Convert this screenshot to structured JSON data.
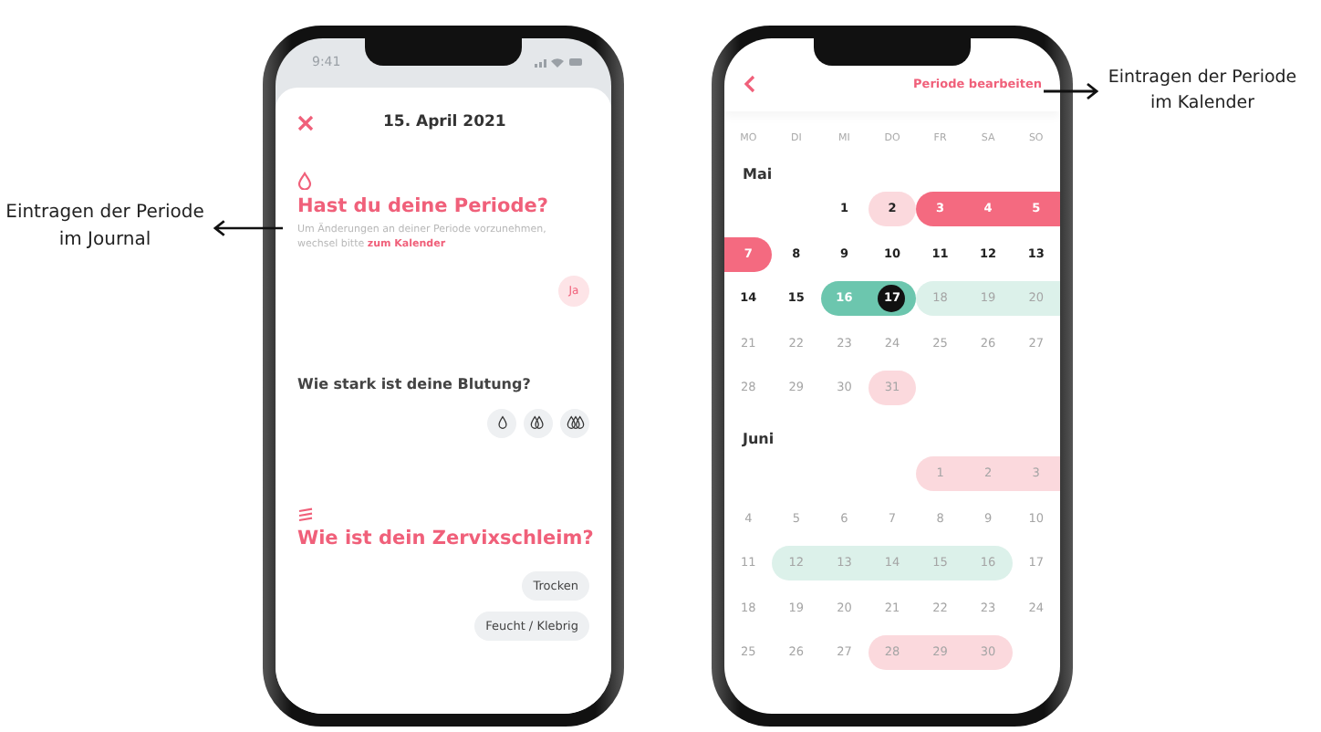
{
  "annotation_left": {
    "text": "Eintragen der Periode im Journal"
  },
  "annotation_right": {
    "text": "Eintragen der Periode im Kalender"
  },
  "journal": {
    "status_time": "9:41",
    "date": "15. April 2021",
    "period_question": "Hast du deine Periode?",
    "hint_text": "Um Änderungen an deiner Periode vorzunehmen, wechsel bitte",
    "hint_link": "zum Kalender",
    "answer": "Ja",
    "flow_question": "Wie stark ist deine Blutung?",
    "flow_levels": [
      {
        "kind": "light"
      },
      {
        "kind": "medium"
      },
      {
        "kind": "heavy"
      }
    ],
    "mucus_question": "Wie ist dein Zervixschleim?",
    "mucus_options": [
      "Trocken",
      "Feucht / Klebrig"
    ]
  },
  "calendar": {
    "action": "Periode bearbeiten",
    "weekdays": [
      "MO",
      "DI",
      "MI",
      "DO",
      "FR",
      "SA",
      "SO"
    ],
    "months": [
      {
        "name": "Mai",
        "weeks": [
          [
            {
              "kind": "empty"
            },
            {
              "kind": "empty"
            },
            {
              "day": "1",
              "kind": "plain",
              "past": true
            },
            {
              "day": "2",
              "kind": "period-light",
              "past": true
            },
            {
              "day": "3",
              "kind": "period",
              "past": true
            },
            {
              "day": "4",
              "kind": "period",
              "past": true
            },
            {
              "day": "5",
              "kind": "period",
              "past": true
            }
          ],
          [
            {
              "day": "7",
              "kind": "period",
              "past": true
            },
            {
              "day": "8",
              "kind": "plain",
              "past": true
            },
            {
              "day": "9",
              "kind": "plain",
              "past": true
            },
            {
              "day": "10",
              "kind": "plain",
              "past": true
            },
            {
              "day": "11",
              "kind": "plain",
              "past": true
            },
            {
              "day": "12",
              "kind": "plain",
              "past": true
            },
            {
              "day": "13",
              "kind": "plain",
              "past": true
            }
          ],
          [
            {
              "day": "14",
              "kind": "plain",
              "past": true
            },
            {
              "day": "15",
              "kind": "plain",
              "past": true
            },
            {
              "day": "16",
              "kind": "fertile-peak",
              "past": true
            },
            {
              "day": "17",
              "kind": "today",
              "past": true
            },
            {
              "day": "18",
              "kind": "fertile",
              "past": false
            },
            {
              "day": "19",
              "kind": "fertile",
              "past": false
            },
            {
              "day": "20",
              "kind": "fertile",
              "past": false
            }
          ],
          [
            {
              "day": "21",
              "kind": "plain",
              "past": false
            },
            {
              "day": "22",
              "kind": "plain",
              "past": false
            },
            {
              "day": "23",
              "kind": "plain",
              "past": false
            },
            {
              "day": "24",
              "kind": "plain",
              "past": false
            },
            {
              "day": "25",
              "kind": "plain",
              "past": false
            },
            {
              "day": "26",
              "kind": "plain",
              "past": false
            },
            {
              "day": "27",
              "kind": "plain",
              "past": false
            }
          ],
          [
            {
              "day": "28",
              "kind": "plain",
              "past": false
            },
            {
              "day": "29",
              "kind": "plain",
              "past": false
            },
            {
              "day": "30",
              "kind": "plain",
              "past": false
            },
            {
              "day": "31",
              "kind": "period-light",
              "past": false
            },
            {
              "kind": "empty"
            },
            {
              "kind": "empty"
            },
            {
              "kind": "empty"
            }
          ]
        ]
      },
      {
        "name": "Juni",
        "weeks": [
          [
            {
              "kind": "empty"
            },
            {
              "kind": "empty"
            },
            {
              "kind": "empty"
            },
            {
              "kind": "empty"
            },
            {
              "day": "1",
              "kind": "period-light",
              "past": false
            },
            {
              "day": "2",
              "kind": "period-light",
              "past": false
            },
            {
              "day": "3",
              "kind": "period-light",
              "past": false
            }
          ],
          [
            {
              "day": "4",
              "kind": "plain",
              "past": false
            },
            {
              "day": "5",
              "kind": "plain",
              "past": false
            },
            {
              "day": "6",
              "kind": "plain",
              "past": false
            },
            {
              "day": "7",
              "kind": "plain",
              "past": false
            },
            {
              "day": "8",
              "kind": "plain",
              "past": false
            },
            {
              "day": "9",
              "kind": "plain",
              "past": false
            },
            {
              "day": "10",
              "kind": "plain",
              "past": false
            }
          ],
          [
            {
              "day": "11",
              "kind": "plain",
              "past": false
            },
            {
              "day": "12",
              "kind": "fertile",
              "past": false
            },
            {
              "day": "13",
              "kind": "fertile",
              "past": false
            },
            {
              "day": "14",
              "kind": "fertile",
              "past": false
            },
            {
              "day": "15",
              "kind": "fertile",
              "past": false
            },
            {
              "day": "16",
              "kind": "fertile",
              "past": false
            },
            {
              "day": "17",
              "kind": "plain",
              "past": false
            }
          ],
          [
            {
              "day": "18",
              "kind": "plain",
              "past": false
            },
            {
              "day": "19",
              "kind": "plain",
              "past": false
            },
            {
              "day": "20",
              "kind": "plain",
              "past": false
            },
            {
              "day": "21",
              "kind": "plain",
              "past": false
            },
            {
              "day": "22",
              "kind": "plain",
              "past": false
            },
            {
              "day": "23",
              "kind": "plain",
              "past": false
            },
            {
              "day": "24",
              "kind": "plain",
              "past": false
            }
          ],
          [
            {
              "day": "25",
              "kind": "plain",
              "past": false
            },
            {
              "day": "26",
              "kind": "plain",
              "past": false
            },
            {
              "day": "27",
              "kind": "plain",
              "past": false
            },
            {
              "day": "28",
              "kind": "period-light",
              "past": false
            },
            {
              "day": "29",
              "kind": "period-light",
              "past": false
            },
            {
              "day": "30",
              "kind": "period-light",
              "past": false
            },
            {
              "kind": "empty"
            }
          ]
        ]
      }
    ]
  }
}
